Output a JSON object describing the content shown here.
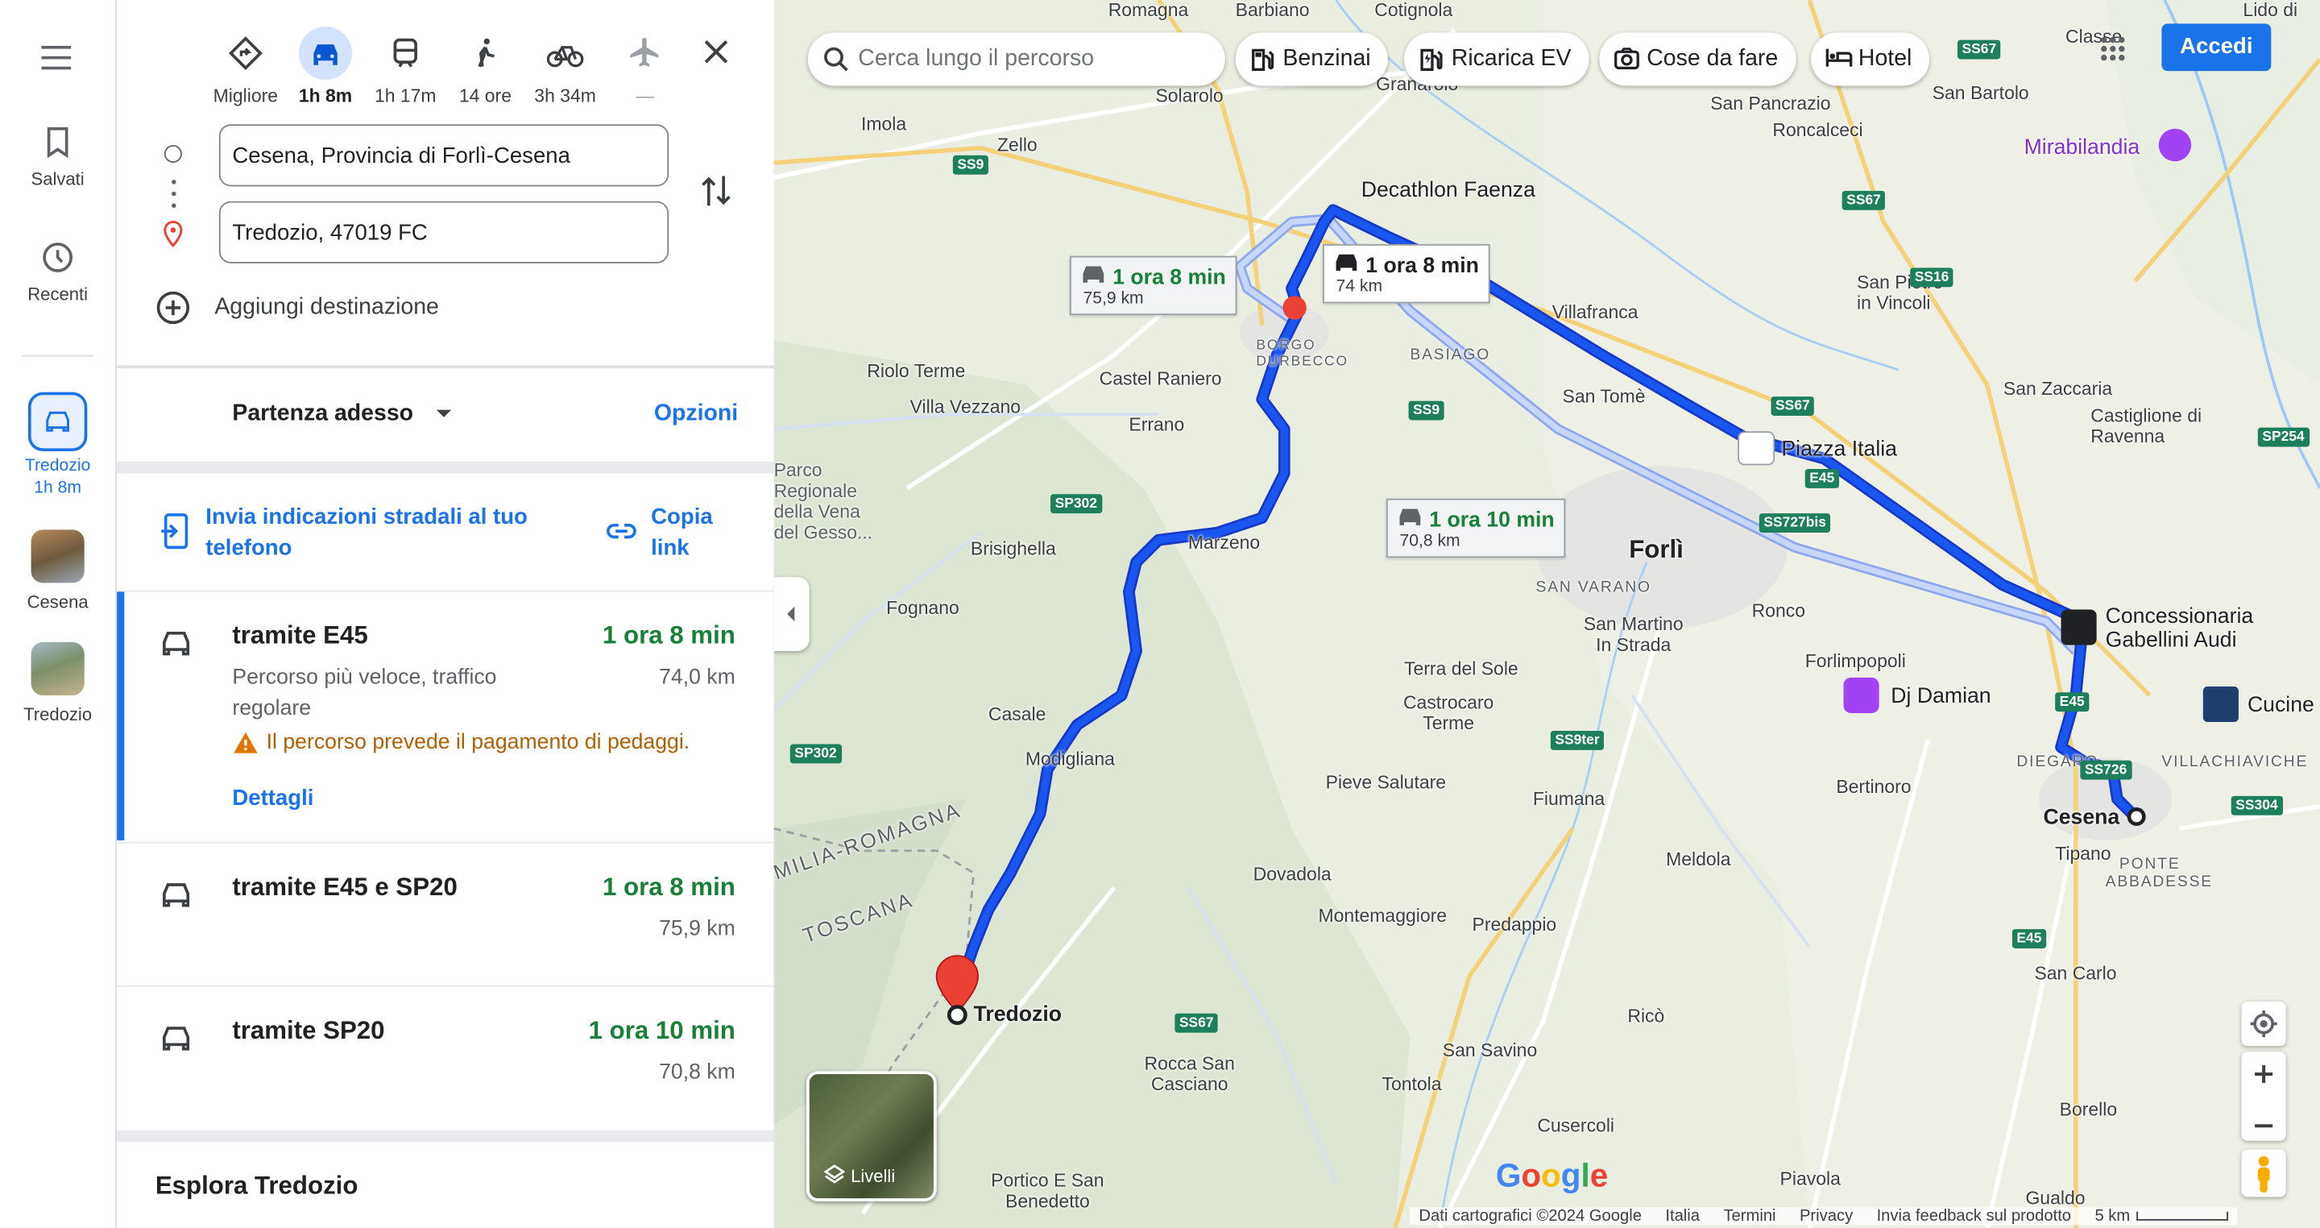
{
  "rail": {
    "menu_icon": "menu-icon",
    "saved": "Salvati",
    "recent": "Recenti",
    "active_dest": "Tredozio",
    "active_time": "1h 8m",
    "thumb1": "Cesena",
    "thumb2": "Tredozio"
  },
  "modes": [
    {
      "label": "Migliore",
      "icon": "diamond-directions-icon"
    },
    {
      "label": "1h 8m",
      "icon": "car-icon",
      "selected": true
    },
    {
      "label": "1h 17m",
      "icon": "train-icon"
    },
    {
      "label": "14 ore",
      "icon": "walk-icon"
    },
    {
      "label": "3h 34m",
      "icon": "bike-icon"
    },
    {
      "label": "—",
      "icon": "plane-icon"
    }
  ],
  "origin": "Cesena, Provincia di Forlì-Cesena",
  "destination": "Tredozio, 47019 FC",
  "add_destination": "Aggiungi destinazione",
  "departure": "Partenza adesso",
  "options": "Opzioni",
  "send_to_phone": "Invia indicazioni stradali al tuo telefono",
  "copy_link": "Copia link",
  "routes": [
    {
      "name": "tramite E45",
      "time": "1 ora 8 min",
      "distance": "74,0 km",
      "description": "Percorso più veloce, traffico regolare",
      "warning": "Il percorso prevede il pagamento di pedaggi.",
      "details": "Dettagli"
    },
    {
      "name": "tramite E45 e SP20",
      "time": "1 ora 8 min",
      "distance": "75,9 km"
    },
    {
      "name": "tramite SP20",
      "time": "1 ora 10 min",
      "distance": "70,8 km"
    }
  ],
  "explore": "Esplora Tredozio",
  "map": {
    "search_placeholder": "Cerca lungo il percorso",
    "chips": [
      "Benzinai",
      "Ricarica EV",
      "Cose da fare",
      "Hotel"
    ],
    "signin": "Accedi",
    "layers": "Livelli",
    "callouts": [
      {
        "time": "1 ora 8 min",
        "dist": "75,9 km"
      },
      {
        "time": "1 ora 8 min",
        "dist": "74 km"
      },
      {
        "time": "1 ora 10 min",
        "dist": "70,8 km"
      }
    ],
    "places": [
      "Romagna",
      "Barbiano",
      "Cotignola",
      "Lido di",
      "Classe",
      "Solarolo",
      "Granarolo",
      "San Pancrazio",
      "San Bartolo",
      "Imola",
      "Zello",
      "Roncalceci",
      "Mirabilandia",
      "Decathlon Faenza",
      "San Pietro in Vincoli",
      "Villafranca",
      "Riolo Terme",
      "Villa Vezzano",
      "Castel Raniero",
      "BORGO DURBECCO",
      "BASIAGO",
      "San Tomè",
      "San Zaccaria",
      "Castiglione di Ravenna",
      "Errano",
      "Piazza Italia",
      "Parco Regionale della Vena del Gesso...",
      "Forlì",
      "Marzeno",
      "Brisighella",
      "SAN VARANO",
      "Ronco",
      "San Martino In Strada",
      "Concessionaria Gabellini Audi",
      "Fognano",
      "Terra del Sole",
      "Forlimpopoli",
      "Dj Damian",
      "Cucine",
      "Castrocaro Terme",
      "Casale",
      "Modigliana",
      "DIEGARO",
      "VILLACHIAVICHE",
      "Cesena",
      "Pieve Salutare",
      "Fiumana",
      "Bertinoro",
      "Tipano",
      "PONTE ABBADESSE",
      "EMILIA-ROMAGNA",
      "TOSCANA",
      "Dovadola",
      "Meldola",
      "Montemaggiore",
      "Predappio",
      "San Carlo",
      "Tredozio",
      "Ricò",
      "San Savino",
      "Rocca San Casciano",
      "Tontola",
      "Borello",
      "Cusercoli",
      "Portico E San Benedetto",
      "Piavola",
      "Gualdo",
      "Google"
    ],
    "roads": [
      "SS9",
      "SS67",
      "SS16",
      "SP254",
      "SS727bis",
      "E45",
      "SP302",
      "SS9ter",
      "SS726",
      "SS304",
      "SS67",
      "Classe"
    ],
    "footer": [
      "Dati cartografici ©2024 Google",
      "Italia",
      "Termini",
      "Privacy",
      "Invia feedback sul prodotto",
      "5 km"
    ],
    "colors": {
      "route": "#1a57f0",
      "alt_route": "#aabdf5",
      "time_green": "#188038",
      "link_blue": "#1a73e8"
    }
  }
}
